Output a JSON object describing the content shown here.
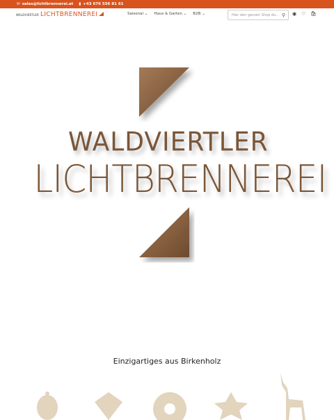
{
  "topbar": {
    "email": "sales@lichtbrennerei.at",
    "phone": "+43 676 556 81 61",
    "color": "#d9531e"
  },
  "header": {
    "logo_small": "WALDVIERTLER",
    "logo_big": "LICHTBRENNEREI",
    "nav": [
      {
        "label": "Saisonal"
      },
      {
        "label": "Haus & Garten"
      },
      {
        "label": "B2B"
      }
    ],
    "search_placeholder": "Hier den ganzen Shop du...",
    "icons": [
      "account-icon",
      "wishlist-icon",
      "cart-icon"
    ]
  },
  "hero": {
    "line1": "WALDVIERTLER",
    "line2": "LICHTBRENNEREI",
    "wood_color": "#7a5638"
  },
  "section": {
    "title": "Einzigartiges aus Birkenholz",
    "products": [
      {
        "name": "ornament-bauble"
      },
      {
        "name": "ornament-leaf"
      },
      {
        "name": "ornament-snowflake"
      },
      {
        "name": "ornament-star"
      },
      {
        "name": "ornament-deer"
      }
    ]
  }
}
